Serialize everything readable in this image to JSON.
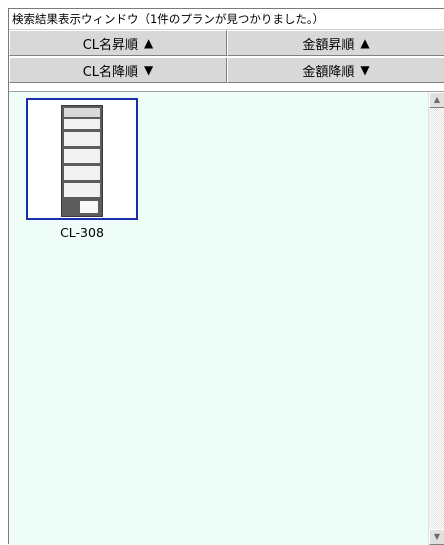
{
  "window": {
    "title": "検索結果表示ウィンドウ（1件のプランが見つかりました。）"
  },
  "sort": {
    "name_asc": "CL名昇順",
    "price_asc": "金額昇順",
    "name_desc": "CL名降順",
    "price_desc": "金額降順",
    "asc_icon": "▲",
    "desc_icon": "▼"
  },
  "results": {
    "items": [
      {
        "label": "CL-308",
        "icon": "shelf-thumbnail"
      }
    ]
  },
  "scrollbar": {
    "up": "▲",
    "down": "▼"
  },
  "colors": {
    "results_bg": "#effdf8",
    "button_bg": "#d8d8d8",
    "selection_border": "#1a2fb0"
  }
}
